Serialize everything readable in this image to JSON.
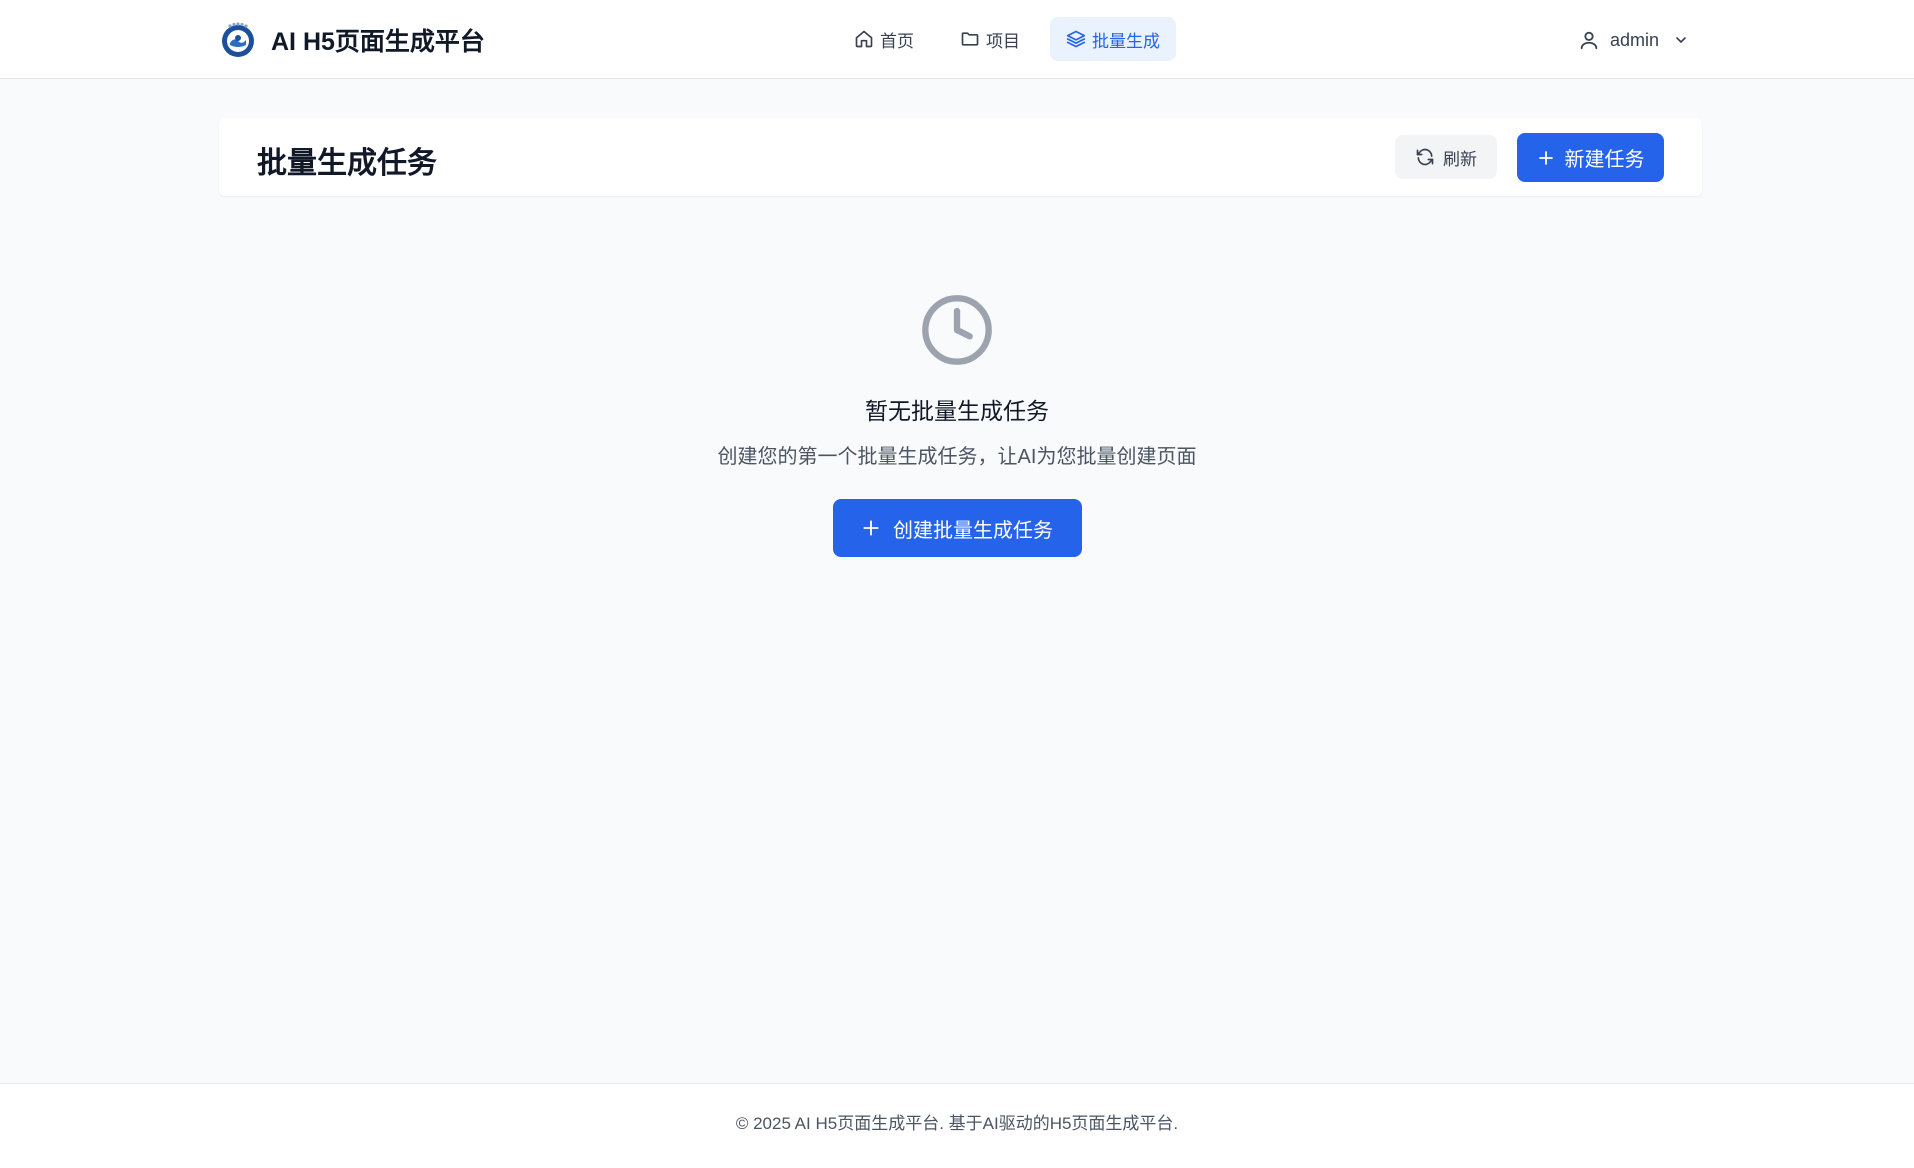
{
  "brand": {
    "title": "AI H5页面生成平台",
    "logo_icon": "emblem-logo"
  },
  "nav": {
    "items": [
      {
        "label": "首页",
        "icon": "home-icon",
        "active": false
      },
      {
        "label": "项目",
        "icon": "folder-icon",
        "active": false
      },
      {
        "label": "批量生成",
        "icon": "layers-icon",
        "active": true
      }
    ]
  },
  "user": {
    "name": "admin",
    "icon": "user-icon"
  },
  "page": {
    "title": "批量生成任务",
    "refresh_label": "刷新",
    "new_task_label": "新建任务"
  },
  "empty_state": {
    "icon": "clock-icon",
    "title": "暂无批量生成任务",
    "description": "创建您的第一个批量生成任务，让AI为您批量创建页面",
    "create_label": "创建批量生成任务"
  },
  "footer": {
    "text": "© 2025 AI H5页面生成平台. 基于AI驱动的H5页面生成平台."
  },
  "colors": {
    "primary": "#2563eb",
    "active_nav_bg": "#eaf2fe",
    "page_bg": "#f8fafc",
    "muted_icon": "#9ca3af"
  }
}
